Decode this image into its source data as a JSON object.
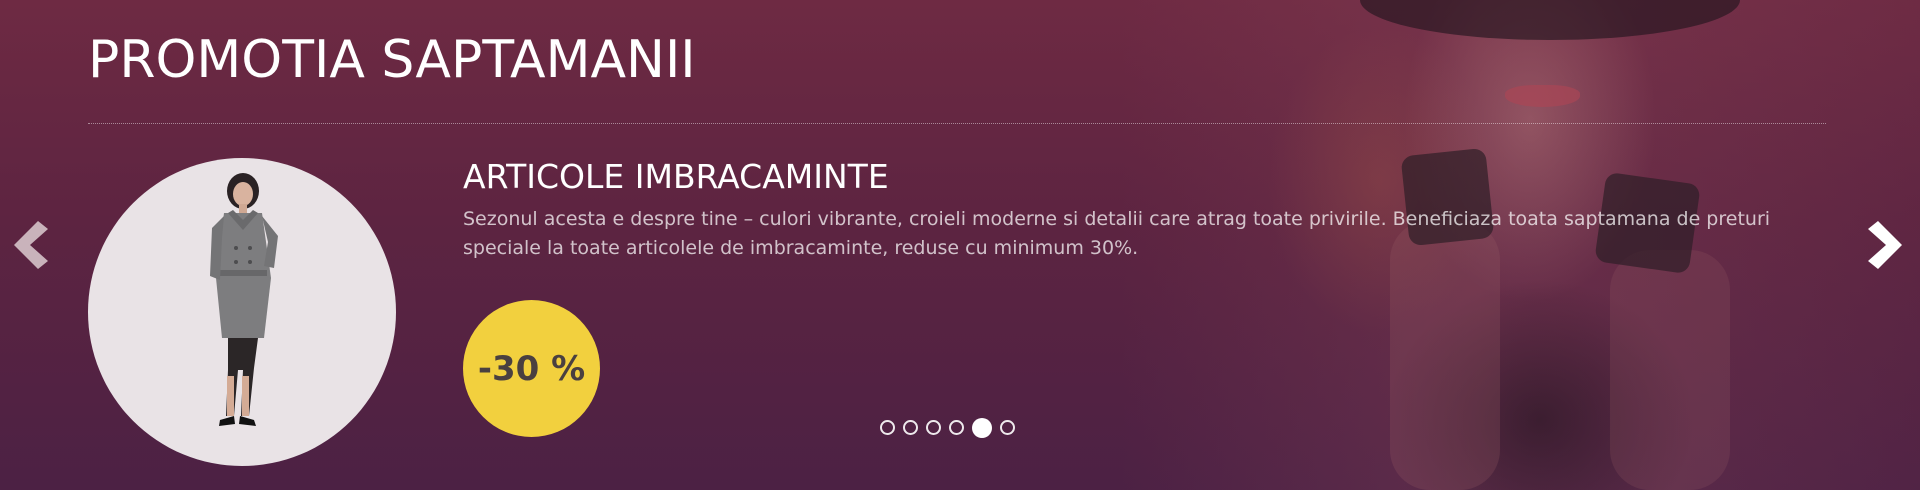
{
  "banner": {
    "title": "PROMOTIA SAPTAMANII",
    "product": {
      "title": "ARTICOLE IMBRACAMINTE",
      "description": "Sezonul acesta e despre tine – culori vibrante, croieli moderne si detalii care atrag toate privirile. Beneficiaza toata saptamana de preturi speciale la toate articolele de imbracaminte, reduse cu minimum 30%.",
      "discount": "-30 %"
    },
    "carousel": {
      "slide_count": 6,
      "active_index": 4
    },
    "colors": {
      "background": "#5d2441",
      "badge": "#f2d03e",
      "badge_text": "#4a4040",
      "text": "#ffffff"
    },
    "icons": {
      "prev": "chevron-left-icon",
      "next": "chevron-right-icon"
    }
  }
}
